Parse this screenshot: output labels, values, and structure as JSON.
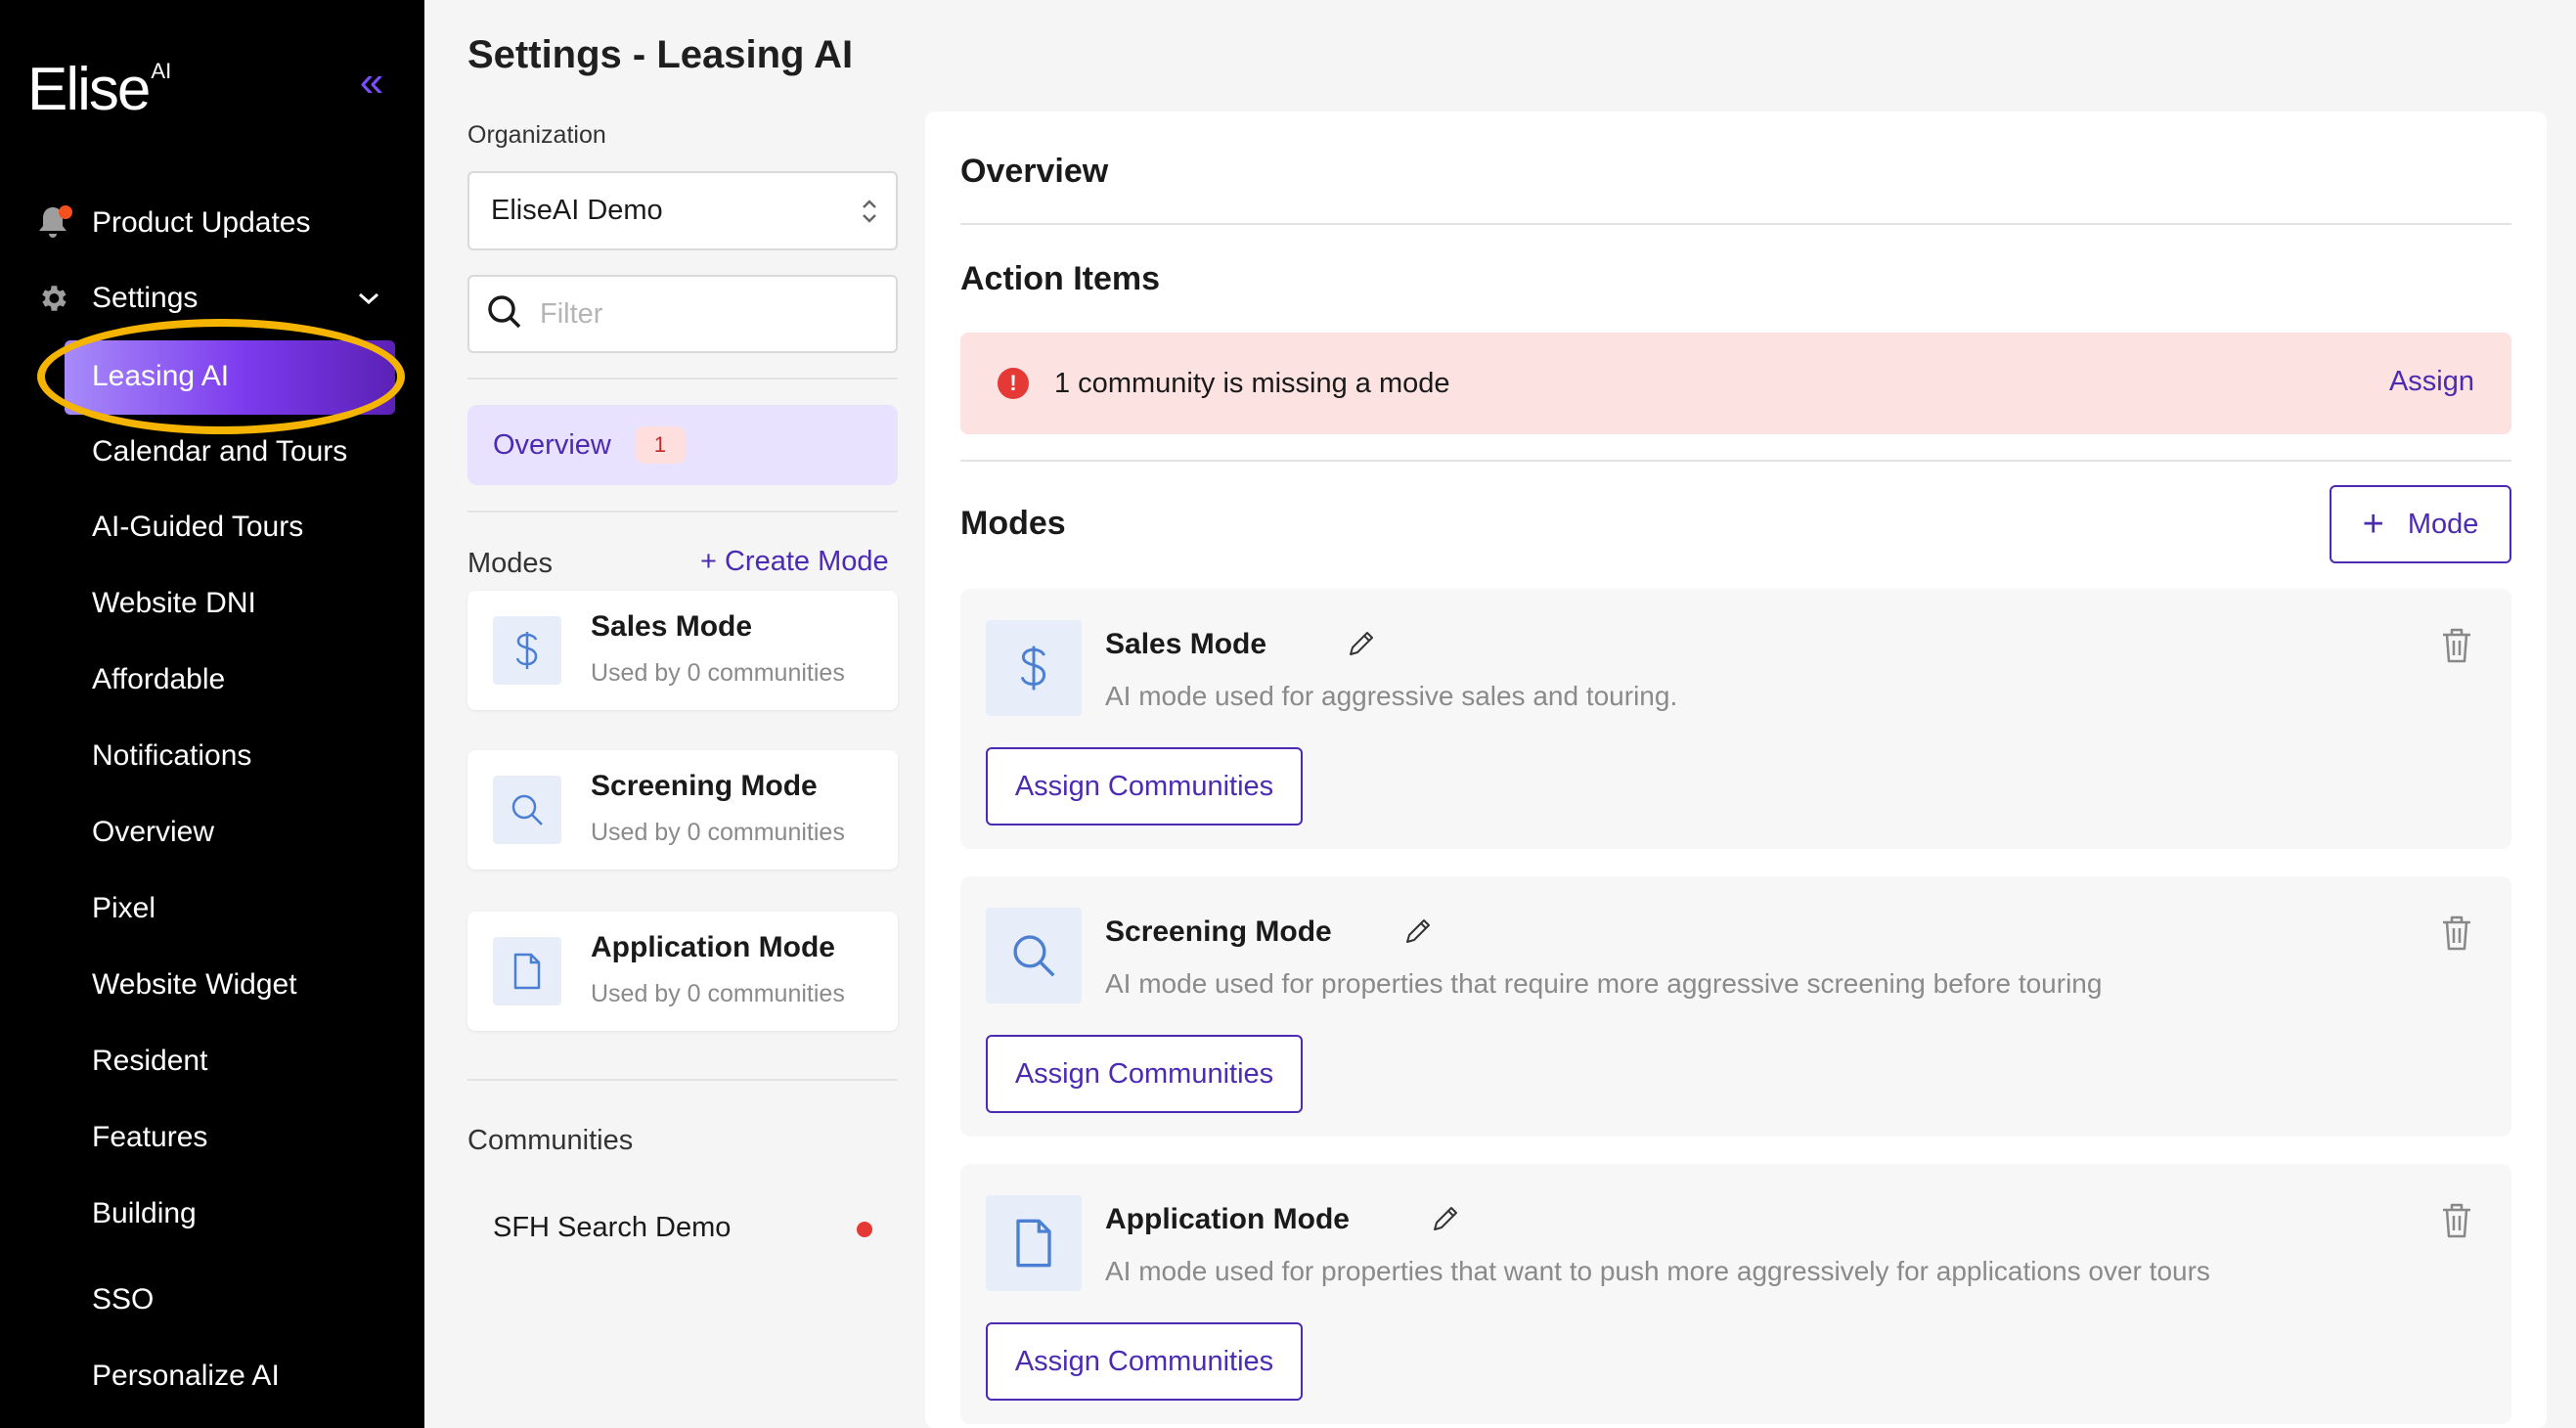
{
  "sidebar": {
    "logo": "Elise",
    "logo_suffix": "AI",
    "collapse_glyph": "«",
    "product_updates": "Product Updates",
    "settings": "Settings",
    "items": [
      {
        "label": "Leasing AI",
        "active": true
      },
      {
        "label": "Calendar and Tours"
      },
      {
        "label": "AI-Guided Tours"
      },
      {
        "label": "Website DNI"
      },
      {
        "label": "Affordable"
      },
      {
        "label": "Notifications"
      },
      {
        "label": "Overview"
      },
      {
        "label": "Pixel"
      },
      {
        "label": "Website Widget"
      },
      {
        "label": "Resident"
      },
      {
        "label": "Features"
      },
      {
        "label": "Building"
      },
      {
        "label": "SSO"
      },
      {
        "label": "Personalize AI"
      }
    ]
  },
  "header": {
    "title": "Settings - Leasing AI"
  },
  "middle": {
    "org_label": "Organization",
    "org_value": "EliseAI Demo",
    "filter_placeholder": "Filter",
    "overview_label": "Overview",
    "overview_badge": "1",
    "modes_label": "Modes",
    "create_mode": "+ Create Mode",
    "modes": [
      {
        "title": "Sales Mode",
        "subtitle": "Used by 0 communities",
        "icon": "dollar-icon"
      },
      {
        "title": "Screening Mode",
        "subtitle": "Used by 0 communities",
        "icon": "search-icon"
      },
      {
        "title": "Application Mode",
        "subtitle": "Used by 0 communities",
        "icon": "document-icon"
      }
    ],
    "communities_label": "Communities",
    "communities": [
      {
        "name": "SFH Search Demo",
        "status_color": "#e53935"
      }
    ]
  },
  "panel": {
    "overview_heading": "Overview",
    "action_items_heading": "Action Items",
    "alert": {
      "text": "1 community is missing a mode",
      "action": "Assign",
      "icon_glyph": "!"
    },
    "modes_heading": "Modes",
    "add_mode_plus": "+",
    "add_mode_label": "Mode",
    "modes": [
      {
        "title": "Sales Mode",
        "description": "AI mode used for aggressive sales and touring.",
        "assign_label": "Assign Communities",
        "icon": "dollar-icon"
      },
      {
        "title": "Screening Mode",
        "description": "AI mode used for properties that require more aggressive screening before touring",
        "assign_label": "Assign Communities",
        "icon": "search-icon"
      },
      {
        "title": "Application Mode",
        "description": "AI mode used for properties that want to push more aggressively for applications over tours",
        "assign_label": "Assign Communities",
        "icon": "document-icon"
      }
    ]
  },
  "colors": {
    "accent": "#4c2bb3",
    "sidebar_bg": "#000000",
    "alert_bg": "#fde2e2",
    "highlight_ring": "#f5b400"
  }
}
